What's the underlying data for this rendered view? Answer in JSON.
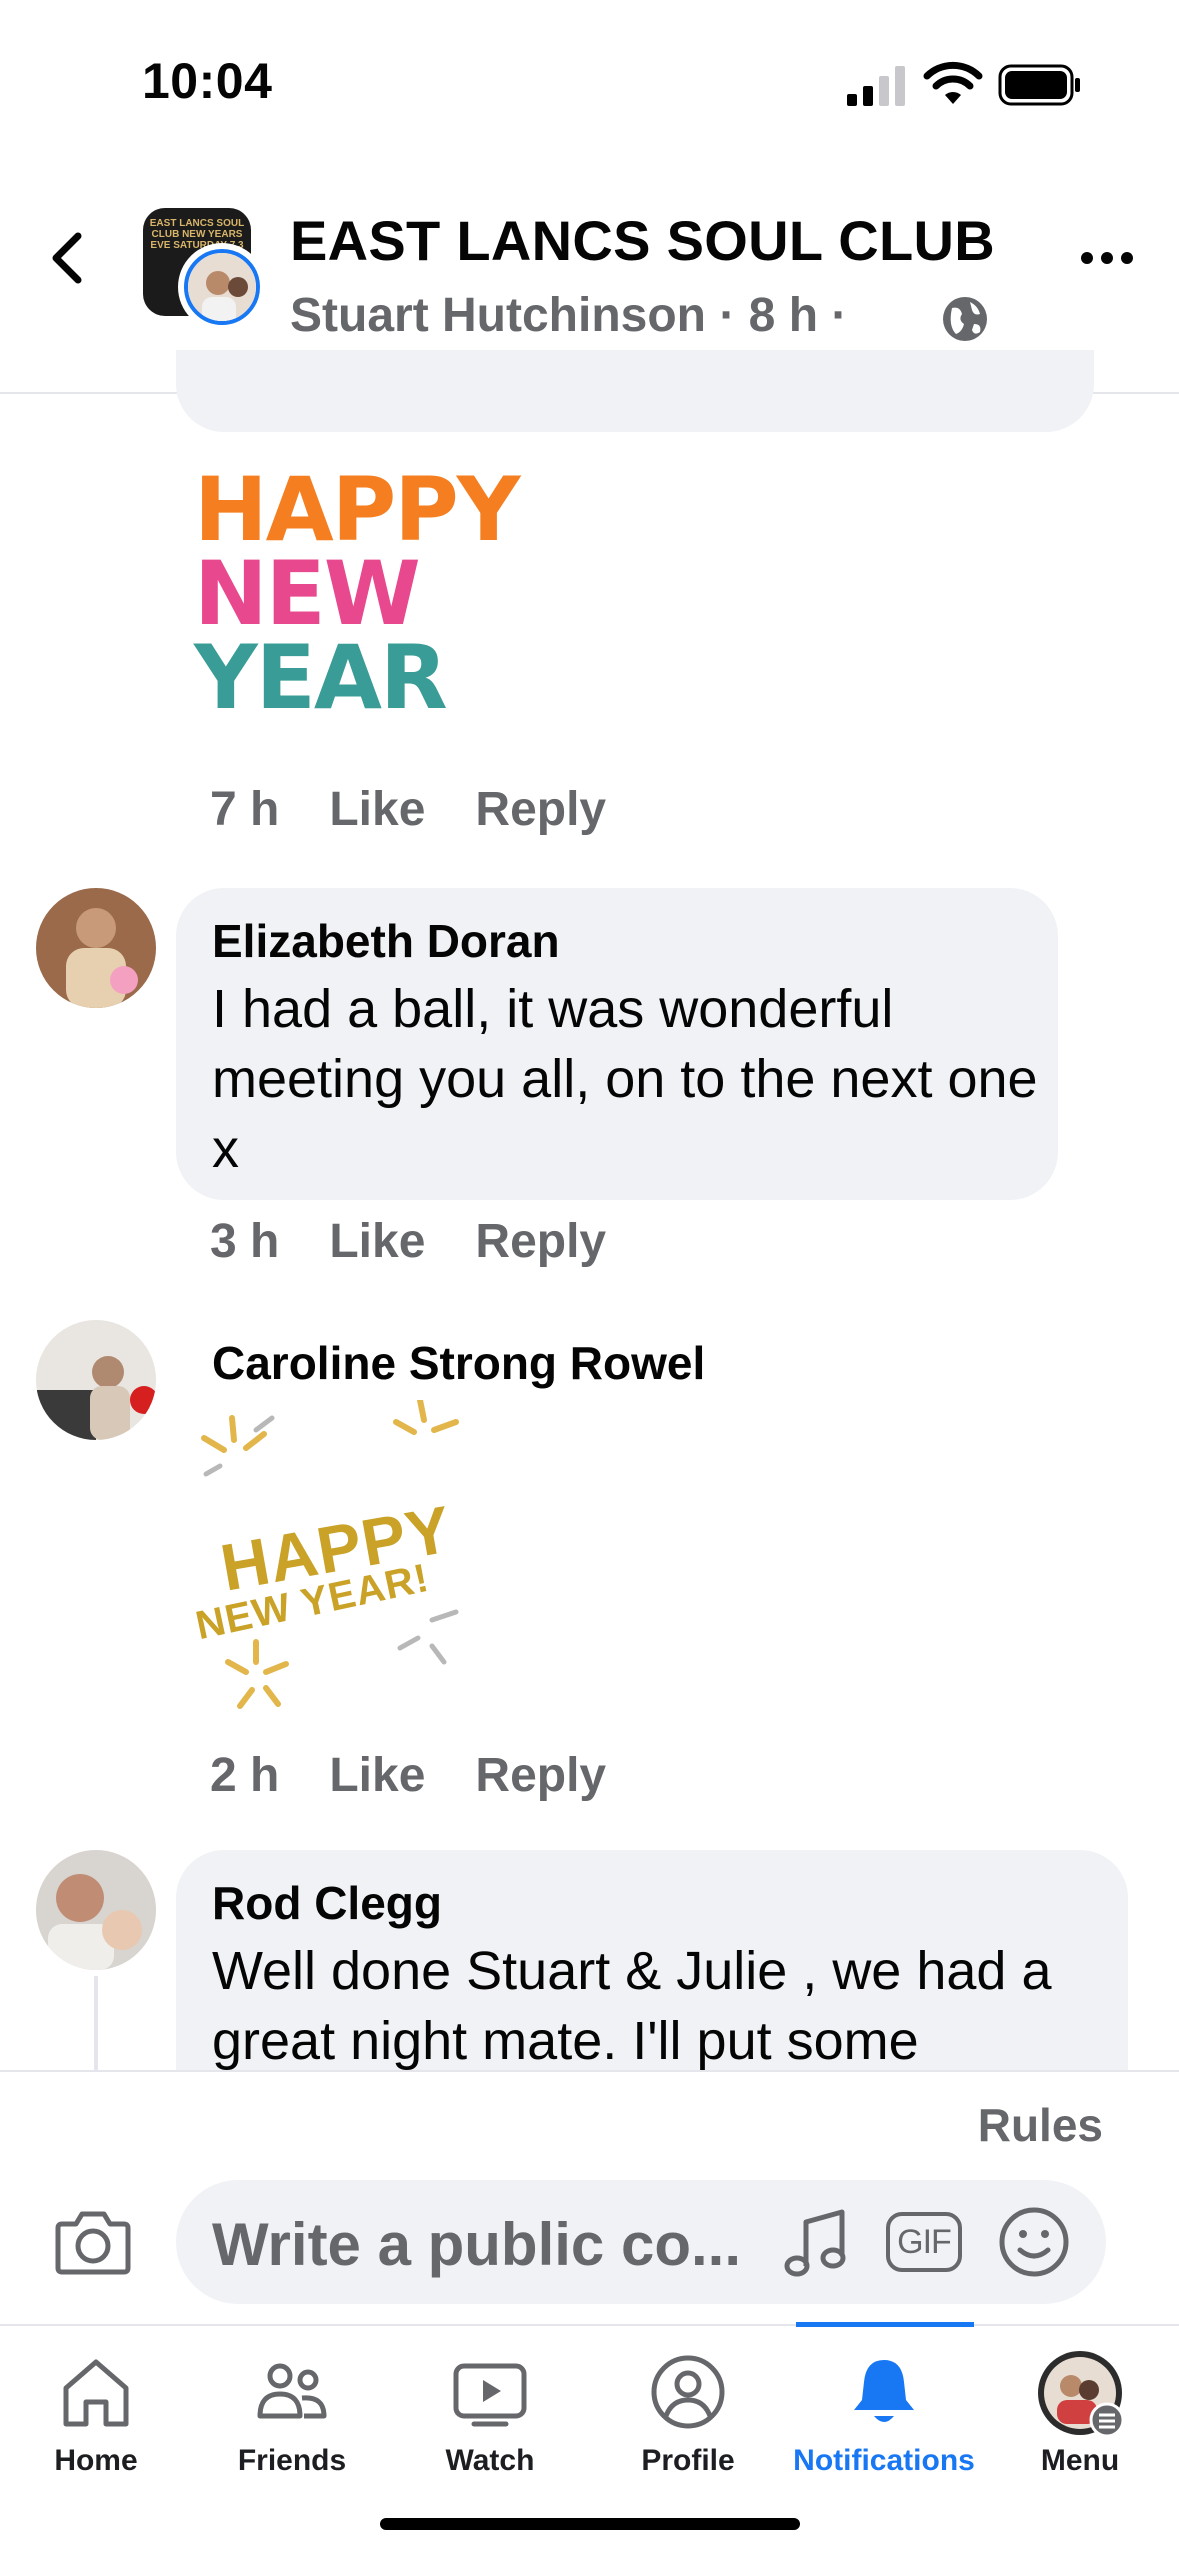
{
  "status_bar": {
    "time": "10:04"
  },
  "header": {
    "group_name": "EAST LANCS SOUL CLUB",
    "author": "Stuart Hutchinson",
    "sep1": "·",
    "time": "8 h",
    "sep2": "·",
    "group_avatar_text": "EAST LANCS SOUL CLUB NEW YEARS EVE SATURDAY 7.3"
  },
  "comments": [
    {
      "sticker_lines": [
        "HAPPY",
        "NEW",
        "YEAR"
      ],
      "time": "7 h",
      "like": "Like",
      "reply": "Reply"
    },
    {
      "name": "Elizabeth Doran",
      "text": "I had a ball, it was wonderful meeting you all, on to the next one x",
      "time": "3 h",
      "like": "Like",
      "reply": "Reply"
    },
    {
      "name": "Caroline Strong Rowel",
      "sticker_lines": [
        "HAPPY",
        "NEW YEAR!"
      ],
      "time": "2 h",
      "like": "Like",
      "reply": "Reply"
    },
    {
      "name": "Rod Clegg",
      "text": "Well done Stuart & Julie , we had a great night mate. I'll put some"
    }
  ],
  "composer": {
    "rules": "Rules",
    "placeholder": "Write a public co...",
    "gif": "GIF"
  },
  "tabs": [
    {
      "label": "Home",
      "icon": "home-icon"
    },
    {
      "label": "Friends",
      "icon": "friends-icon"
    },
    {
      "label": "Watch",
      "icon": "watch-icon"
    },
    {
      "label": "Profile",
      "icon": "profile-icon"
    },
    {
      "label": "Notifications",
      "icon": "bell-icon",
      "active": true
    },
    {
      "label": "Menu",
      "icon": "menu-avatar"
    }
  ],
  "colors": {
    "accent": "#1877f2",
    "bubble": "#f0f2f5",
    "muted": "#65676b"
  }
}
